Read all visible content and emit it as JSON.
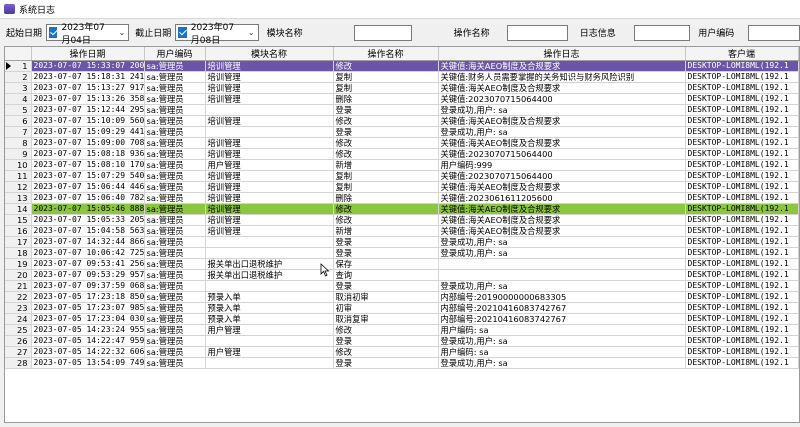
{
  "window": {
    "title": "系统日志"
  },
  "filters": {
    "start_label": "起始日期",
    "start_value": "2023年07月04日",
    "end_label": "截止日期",
    "end_value": "2023年07月08日",
    "module_label": "模块名称",
    "operation_label": "操作名称",
    "log_label": "日志信息",
    "user_label": "用户编码"
  },
  "columns": [
    "操作日期",
    "用户编码",
    "模块名称",
    "操作名称",
    "操作日志",
    "客户端"
  ],
  "rows": [
    {
      "n": "1",
      "date": "2023-07-07 15:33:07 200",
      "user": "sa:管理员",
      "module": "培训管理",
      "op": "修改",
      "log": "关键值:海关AEO制度及合规要求",
      "client": "DESKTOP-LOMI8ML(192.1"
    },
    {
      "n": "2",
      "date": "2023-07-07 15:18:31 241",
      "user": "sa:管理员",
      "module": "培训管理",
      "op": "复制",
      "log": "关键值:财务人员需要掌握的关务知识与财务风险识别",
      "client": "DESKTOP-LOMI8ML(192.1"
    },
    {
      "n": "3",
      "date": "2023-07-07 15:13:27 917",
      "user": "sa:管理员",
      "module": "培训管理",
      "op": "复制",
      "log": "关键值:海关AEO制度及合规要求",
      "client": "DESKTOP-LOMI8ML(192.1"
    },
    {
      "n": "4",
      "date": "2023-07-07 15:13:26 358",
      "user": "sa:管理员",
      "module": "培训管理",
      "op": "删除",
      "log": "关键值:2023070715064400",
      "client": "DESKTOP-LOMI8ML(192.1"
    },
    {
      "n": "5",
      "date": "2023-07-07 15:12:44 295",
      "user": "sa:管理员",
      "module": "",
      "op": "登录",
      "log": "登录成功,用户: sa",
      "client": "DESKTOP-LOMI8ML(192.1"
    },
    {
      "n": "6",
      "date": "2023-07-07 15:10:09 560",
      "user": "sa:管理员",
      "module": "培训管理",
      "op": "修改",
      "log": "关键值:海关AEO制度及合规要求",
      "client": "DESKTOP-LOMI8ML(192.1"
    },
    {
      "n": "7",
      "date": "2023-07-07 15:09:29 441",
      "user": "sa:管理员",
      "module": "",
      "op": "登录",
      "log": "登录成功,用户: sa",
      "client": "DESKTOP-LOMI8ML(192.1"
    },
    {
      "n": "8",
      "date": "2023-07-07 15:09:00 708",
      "user": "sa:管理员",
      "module": "培训管理",
      "op": "修改",
      "log": "关键值:海关AEO制度及合规要求",
      "client": "DESKTOP-LOMI8ML(192.1"
    },
    {
      "n": "9",
      "date": "2023-07-07 15:08:18 936",
      "user": "sa:管理员",
      "module": "培训管理",
      "op": "修改",
      "log": "关键值:2023070715064400",
      "client": "DESKTOP-LOMI8ML(192.1"
    },
    {
      "n": "10",
      "date": "2023-07-07 15:08:10 170",
      "user": "sa:管理员",
      "module": "用户管理",
      "op": "新增",
      "log": "用户编码:999",
      "client": "DESKTOP-LOMI8ML(192.1"
    },
    {
      "n": "11",
      "date": "2023-07-07 15:07:29 540",
      "user": "sa:管理员",
      "module": "培训管理",
      "op": "复制",
      "log": "关键值:2023070715064400",
      "client": "DESKTOP-LOMI8ML(192.1"
    },
    {
      "n": "12",
      "date": "2023-07-07 15:06:44 446",
      "user": "sa:管理员",
      "module": "培训管理",
      "op": "复制",
      "log": "关键值:海关AEO制度及合规要求",
      "client": "DESKTOP-LOMI8ML(192.1"
    },
    {
      "n": "13",
      "date": "2023-07-07 15:06:40 782",
      "user": "sa:管理员",
      "module": "培训管理",
      "op": "删除",
      "log": "关键值:2023061611205600",
      "client": "DESKTOP-LOMI8ML(192.1"
    },
    {
      "n": "14",
      "date": "2023-07-07 15:05:46 888",
      "user": "sa:管理员",
      "module": "培训管理",
      "op": "修改",
      "log": "关键值:海关AEO制度及合规要求",
      "client": "DESKTOP-LOMI8ML(192.1"
    },
    {
      "n": "15",
      "date": "2023-07-07 15:05:33 205",
      "user": "sa:管理员",
      "module": "培训管理",
      "op": "修改",
      "log": "关键值:海关AEO制度及合规要求",
      "client": "DESKTOP-LOMI8ML(192.1"
    },
    {
      "n": "16",
      "date": "2023-07-07 15:04:58 563",
      "user": "sa:管理员",
      "module": "培训管理",
      "op": "新增",
      "log": "关键值:海关AEO制度及合规要求",
      "client": "DESKTOP-LOMI8ML(192.1"
    },
    {
      "n": "17",
      "date": "2023-07-07 14:32:44 866",
      "user": "sa:管理员",
      "module": "",
      "op": "登录",
      "log": "登录成功,用户: sa",
      "client": "DESKTOP-LOMI8ML(192.1"
    },
    {
      "n": "18",
      "date": "2023-07-07 10:06:42 725",
      "user": "sa:管理员",
      "module": "",
      "op": "登录",
      "log": "登录成功,用户: sa",
      "client": "DESKTOP-LOMI8ML(192.1"
    },
    {
      "n": "19",
      "date": "2023-07-07 09:53:41 256",
      "user": "sa:管理员",
      "module": "报关单出口退税维护",
      "op": "保存",
      "log": "",
      "client": "DESKTOP-LOMI8ML(192.1"
    },
    {
      "n": "20",
      "date": "2023-07-07 09:53:29 957",
      "user": "sa:管理员",
      "module": "报关单出口退税维护",
      "op": "查询",
      "log": "",
      "client": "DESKTOP-LOMI8ML(192.1"
    },
    {
      "n": "21",
      "date": "2023-07-07 09:37:59 068",
      "user": "sa:管理员",
      "module": "",
      "op": "登录",
      "log": "登录成功,用户: sa",
      "client": "DESKTOP-LOMI8ML(192.1"
    },
    {
      "n": "22",
      "date": "2023-07-05 17:23:18 850",
      "user": "sa:管理员",
      "module": "预录入单",
      "op": "取消初审",
      "log": "内部编号:20190000000683305",
      "client": "DESKTOP-LOMI8ML(192.1"
    },
    {
      "n": "23",
      "date": "2023-07-05 17:23:07 985",
      "user": "sa:管理员",
      "module": "预录入单",
      "op": "初审",
      "log": "内部编号:20210416083742767",
      "client": "DESKTOP-LOMI8ML(192.1"
    },
    {
      "n": "24",
      "date": "2023-07-05 17:23:04 030",
      "user": "sa:管理员",
      "module": "预录入单",
      "op": "取消复审",
      "log": "内部编号:20210416083742767",
      "client": "DESKTOP-LOMI8ML(192.1"
    },
    {
      "n": "25",
      "date": "2023-07-05 14:23:24 955",
      "user": "sa:管理员",
      "module": "用户管理",
      "op": "修改",
      "log": "用户编码: sa",
      "client": "DESKTOP-LOMI8ML(192.1"
    },
    {
      "n": "26",
      "date": "2023-07-05 14:22:47 959",
      "user": "sa:管理员",
      "module": "",
      "op": "登录",
      "log": "登录成功,用户: sa",
      "client": "DESKTOP-LOMI8ML(192.1"
    },
    {
      "n": "27",
      "date": "2023-07-05 14:22:32 606",
      "user": "sa:管理员",
      "module": "用户管理",
      "op": "修改",
      "log": "用户编码: sa",
      "client": "DESKTOP-LOMI8ML(192.1"
    },
    {
      "n": "28",
      "date": "2023-07-05 13:54:09 749",
      "user": "sa:管理员",
      "module": "",
      "op": "登录",
      "log": "登录成功,用户: sa",
      "client": "DESKTOP-LOMI8ML(192.1"
    }
  ],
  "selected_row": 1,
  "highlighted_row": 14,
  "colors": {
    "selected": "#6a55a8",
    "highlight": "#8cc63e",
    "checkbox": "#1a73c8"
  }
}
